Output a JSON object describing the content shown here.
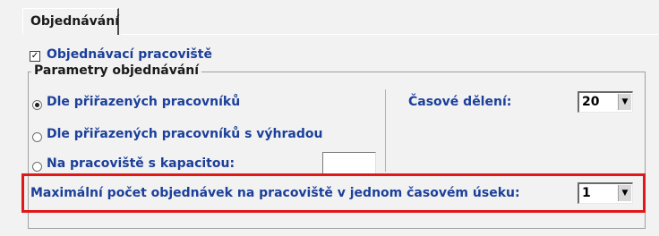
{
  "tab": {
    "label": "Objednávání"
  },
  "ordering_workplace": {
    "label": "Objednávací pracoviště",
    "checked": true
  },
  "params_group": {
    "legend": "Parametry objednávání"
  },
  "radios": [
    {
      "label": "Dle přiřazených pracovníků",
      "selected": true
    },
    {
      "label": "Dle přiřazených pracovníků s výhradou",
      "selected": false
    },
    {
      "label": "Na pracoviště s kapacitou:",
      "selected": false
    }
  ],
  "capacity_input": {
    "value": ""
  },
  "time_division": {
    "label": "Časové dělení:",
    "value": "20"
  },
  "max_orders": {
    "label": "Maximální počet objednávek na pracoviště v jednom časovém úseku:",
    "value": "1"
  },
  "colors": {
    "highlight": "#e01818",
    "label_blue": "#1b3f9a"
  },
  "icons": {
    "check": "checkmark-icon",
    "dropdown": "chevron-down-icon"
  }
}
